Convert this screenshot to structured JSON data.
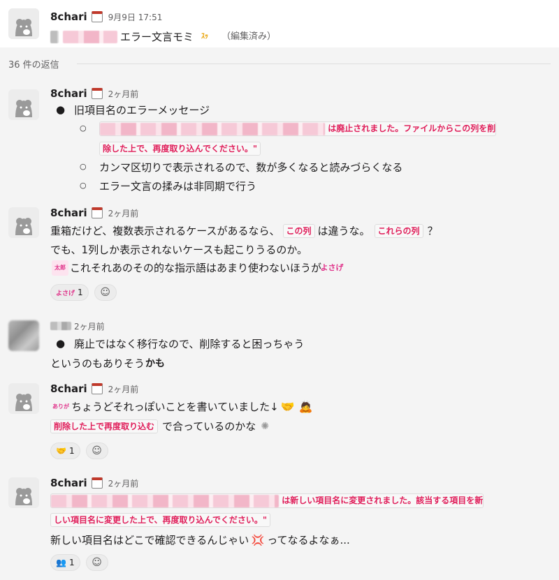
{
  "parent": {
    "user": "8chari",
    "time": "9月9日 17:51",
    "text": "エラー文言モミ",
    "edited": "（編集済み）"
  },
  "replies_label": "36 件の返信",
  "messages": [
    {
      "user": "8chari",
      "time": "2ヶ月前",
      "bullet1": "旧項目名のエラーメッセージ",
      "sub1_code_a": "は廃止されました。ファイルからこの列を削",
      "sub1_code_b": "除した上で、再度取り込んでください。\"",
      "sub2": "カンマ区切りで表示されるので、数が多くなると読みづらくなる",
      "sub3": "エラー文言の揉みは非同期で行う"
    },
    {
      "user": "8chari",
      "time": "2ヶ月前",
      "line1_a": "重箱だけど、複数表示されるケースがあるなら、",
      "line1_code1": "この列",
      "line1_b": "は違うな。",
      "line1_code2": "これらの列",
      "line1_c": "？",
      "line2": "でも、1列しか表示されないケースも起こりうるのか。",
      "line3": "これそれあのその的な指示語はあまり使わないほうが",
      "reaction_count": "1"
    },
    {
      "time": "2ヶ月前",
      "bullet1": "廃止ではなく移行なので、削除すると困っちゃう",
      "line2": "というのもありそう"
    },
    {
      "user": "8chari",
      "time": "2ヶ月前",
      "line1": "ちょうどそれっぽいことを書いていました↓",
      "line2_code": "削除した上で再度取り込む",
      "line2_b": "で合っているのかな",
      "reaction_count": "1"
    },
    {
      "user": "8chari",
      "time": "2ヶ月前",
      "code_a": "は新しい項目名に変更されました。該当する項目を新",
      "code_b": "しい項目名に変更した上で、再度取り込んでください。\"",
      "line3_a": "新しい項目名はどこで確認できるんじゃい",
      "line3_b": "ってなるよなぁ...",
      "reaction_count": "1"
    }
  ],
  "colors": {
    "code_text": "#e01e5a",
    "background": "#f4f4f4",
    "meta": "#616061"
  },
  "icons": [
    "cat-avatar",
    "calendar-icon",
    "add-reaction-icon",
    "handshake-emoji",
    "angry-emoji"
  ]
}
